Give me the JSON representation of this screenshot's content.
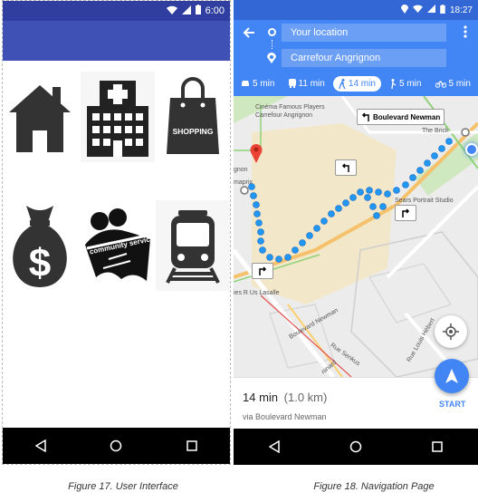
{
  "ui": {
    "status_time": "6:00",
    "captions": {
      "fig17": "Figure 17. User Interface"
    },
    "grid_icons": [
      "home-icon",
      "hospital-icon",
      "shopping-bag-icon",
      "money-bag-icon",
      "community-service-icon",
      "train-icon"
    ],
    "shopping_label": "SHOPPING",
    "community_label": "community service",
    "colors": {
      "status": "#303f9f",
      "appbar": "#3f51b5"
    }
  },
  "nav": {
    "status_time": "18:27",
    "origin": "Your location",
    "destination": "Carrefour Angrignon",
    "modes": [
      {
        "icon": "car-icon",
        "label": "5 min"
      },
      {
        "icon": "transit-icon",
        "label": "11 min"
      },
      {
        "icon": "walk-icon",
        "label": "14 min",
        "active": true
      },
      {
        "icon": "rideshare-icon",
        "label": "5 min"
      },
      {
        "icon": "bike-icon",
        "label": "5 min"
      }
    ],
    "map_labels": {
      "cinema": "Cinéma Famous Players\nCarrefour Angrignon",
      "boulevard_newman_sign": "Boulevard Newman",
      "the_brick": "The Brick",
      "sears": "Sears Portrait Studio",
      "angrignon": "gnon",
      "maprix": "maprix",
      "us_lasalle": "ies R Us Lasalle",
      "boul_newman": "Boulevard Newman",
      "senkus": "Rue Senkus",
      "louis_hebert": "Rue Louis Hébert",
      "ninard": "ninard"
    },
    "duration": "14 min",
    "distance": "(1.0 km)",
    "via": "via Boulevard Newman",
    "start": "START",
    "caption": "Figure 18. Navigation Page",
    "colors": {
      "accent": "#4285f4",
      "route": "#2196f3",
      "pin": "#ea4335"
    }
  }
}
